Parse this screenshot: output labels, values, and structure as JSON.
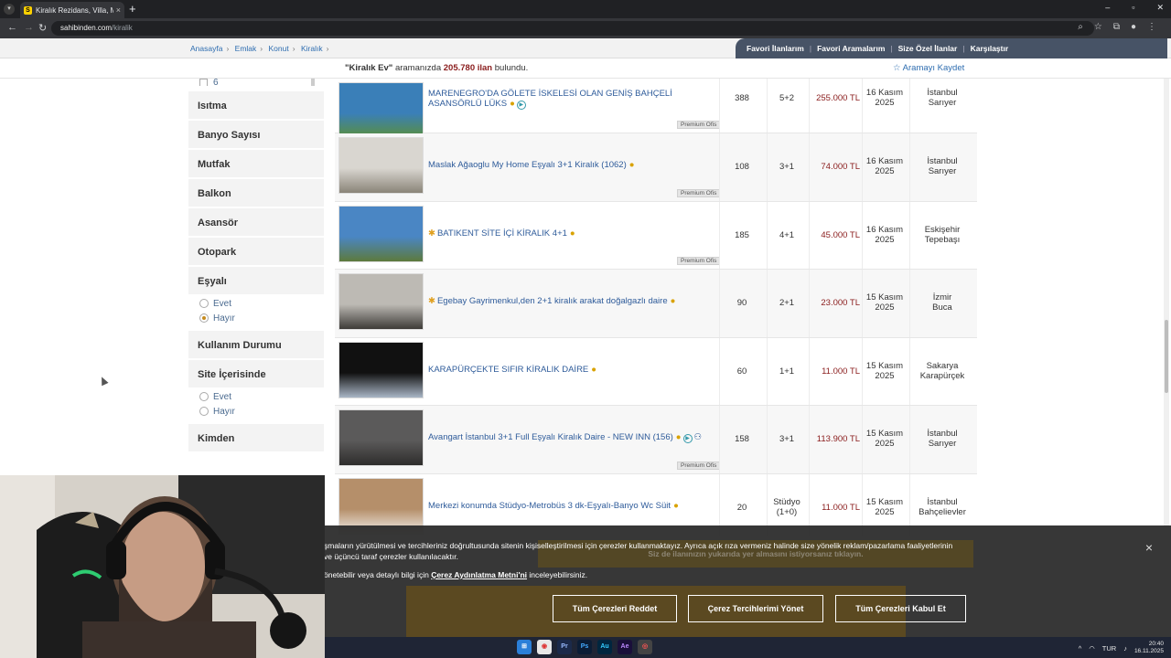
{
  "browser": {
    "tab_title": "Kiralık Rezidans, Villa, Müstakil",
    "tab_favicon": "S",
    "url_host": "sahibinden.com",
    "url_path": "/kiralik",
    "newtab": "+",
    "tab_close": "×",
    "win_min": "–",
    "win_max": "▫",
    "win_close": "✕"
  },
  "breadcrumb": [
    "Anasayfa",
    "Emlak",
    "Konut",
    "Kiralık"
  ],
  "header_nav": [
    "Favori İlanlarım",
    "Favori Aramalarım",
    "Size Özel İlanlar",
    "Karşılaştır"
  ],
  "result": {
    "query": "\"Kiralık Ev\"",
    "middle": " aramanızda ",
    "count": "205.780 ilan",
    "suffix": " bulundu.",
    "save_label": "Aramayı Kaydet"
  },
  "sidebar": {
    "top_checkbox_label": "6",
    "sections": {
      "isitma": "Isıtma",
      "banyo": "Banyo Sayısı",
      "mutfak": "Mutfak",
      "balkon": "Balkon",
      "asansor": "Asansör",
      "otopark": "Otopark",
      "esyali": "Eşyalı",
      "kullanim": "Kullanım Durumu",
      "site": "Site İçerisinde",
      "kimden": "Kimden"
    },
    "esyali_options": [
      "Evet",
      "Hayır"
    ],
    "esyali_selected": "Hayır",
    "site_options": [
      "Evet",
      "Hayır"
    ]
  },
  "listings": [
    {
      "title": "MARENEGRO'DA GÖLETE İSKELESİ OLAN GENİŞ BAHÇELİ ASANSÖRLÜ LÜKS",
      "m2": "388",
      "rooms": "5+2",
      "price": "255.000 TL",
      "date1": "16 Kasım",
      "date2": "2025",
      "loc1": "İstanbul",
      "loc2": "Sarıyer",
      "badge": "Premium Ofis",
      "thumb_color": "#3a7fb8",
      "thumb_color2": "#5a8f3c"
    },
    {
      "title": "Maslak Ağaoglu My Home Eşyalı 3+1 Kiralık (1062)",
      "m2": "108",
      "rooms": "3+1",
      "price": "74.000 TL",
      "date1": "16 Kasım",
      "date2": "2025",
      "loc1": "İstanbul",
      "loc2": "Sarıyer",
      "badge": "Premium Ofis",
      "thumb_color": "#d9d6d0",
      "thumb_color2": "#8a8478"
    },
    {
      "title": "BATIKENT SİTE İÇİ KİRALIK 4+1",
      "m2": "185",
      "rooms": "4+1",
      "price": "45.000 TL",
      "date1": "16 Kasım",
      "date2": "2025",
      "loc1": "Eskişehir",
      "loc2": "Tepebaşı",
      "badge": "Premium Ofis",
      "thumb_color": "#4a86c4",
      "thumb_color2": "#5d7a3d"
    },
    {
      "title": "Egebay Gayrimenkul,den 2+1 kiralık arakat doğalgazlı daire",
      "m2": "90",
      "rooms": "2+1",
      "price": "23.000 TL",
      "date1": "15 Kasım",
      "date2": "2025",
      "loc1": "İzmir",
      "loc2": "Buca",
      "badge": "",
      "thumb_color": "#bdbab4",
      "thumb_color2": "#3d3b38"
    },
    {
      "title": "KARAPÜRÇEKTE SIFIR KİRALIK DAİRE",
      "m2": "60",
      "rooms": "1+1",
      "price": "11.000 TL",
      "date1": "15 Kasım",
      "date2": "2025",
      "loc1": "Sakarya",
      "loc2": "Karapürçek",
      "badge": "",
      "thumb_color": "#111111",
      "thumb_color2": "#a9b6c6"
    },
    {
      "title": "Avangart İstanbul 3+1 Full Eşyalı Kiralık Daire - NEW INN (156)",
      "m2": "158",
      "rooms": "3+1",
      "price": "113.900 TL",
      "date1": "15 Kasım",
      "date2": "2025",
      "loc1": "İstanbul",
      "loc2": "Sarıyer",
      "badge": "Premium Ofis",
      "thumb_color": "#5b5a5a",
      "thumb_color2": "#2e2d2c"
    },
    {
      "title": "Merkezi konumda Stüdyo-Metrobüs 3 dk-Eşyalı-Banyo Wc Süit",
      "m2": "20",
      "rooms": "Stüdyo",
      "rooms2": "(1+0)",
      "price": "11.000 TL",
      "date1": "15 Kasım",
      "date2": "2025",
      "loc1": "İstanbul",
      "loc2": "Bahçelievler",
      "badge": "",
      "thumb_color": "#b58f6a",
      "thumb_color2": "#f0ece6"
    }
  ],
  "cookie": {
    "line1": "şmaların yürütülmesi ve tercihleriniz doğrultusunda sitenin kişiselleştirilmesi için çerezler kullanmaktayız. Ayrıca açık rıza vermeniz halinde size yönelik reklam/pazarlama faaliyetlerinin",
    "line2": "ve üçüncü taraf çerezler kullanılacaktır.",
    "line3_prefix": "önetebilir veya detaylı bilgi için ",
    "line3_link": "Çerez Aydınlatma Metni'ni",
    "line3_suffix": " inceleyebilirsiniz.",
    "btn_reject": "Tüm Çerezleri Reddet",
    "btn_prefs": "Çerez Tercihlerimi Yönet",
    "btn_accept": "Tüm Çerezleri Kabul Et",
    "close": "×",
    "ad_text": "Siz de ilanınızın yukarıda yer almasını istiyorsanız tıklayın."
  },
  "taskbar": {
    "lang": "TUR",
    "time": "20:40",
    "date": "16.11.2025"
  },
  "colors": {
    "nav_bg": "#475366",
    "price": "#8a1c1c",
    "link": "#2e5b9a",
    "accent_yellow": "#ffd200"
  }
}
